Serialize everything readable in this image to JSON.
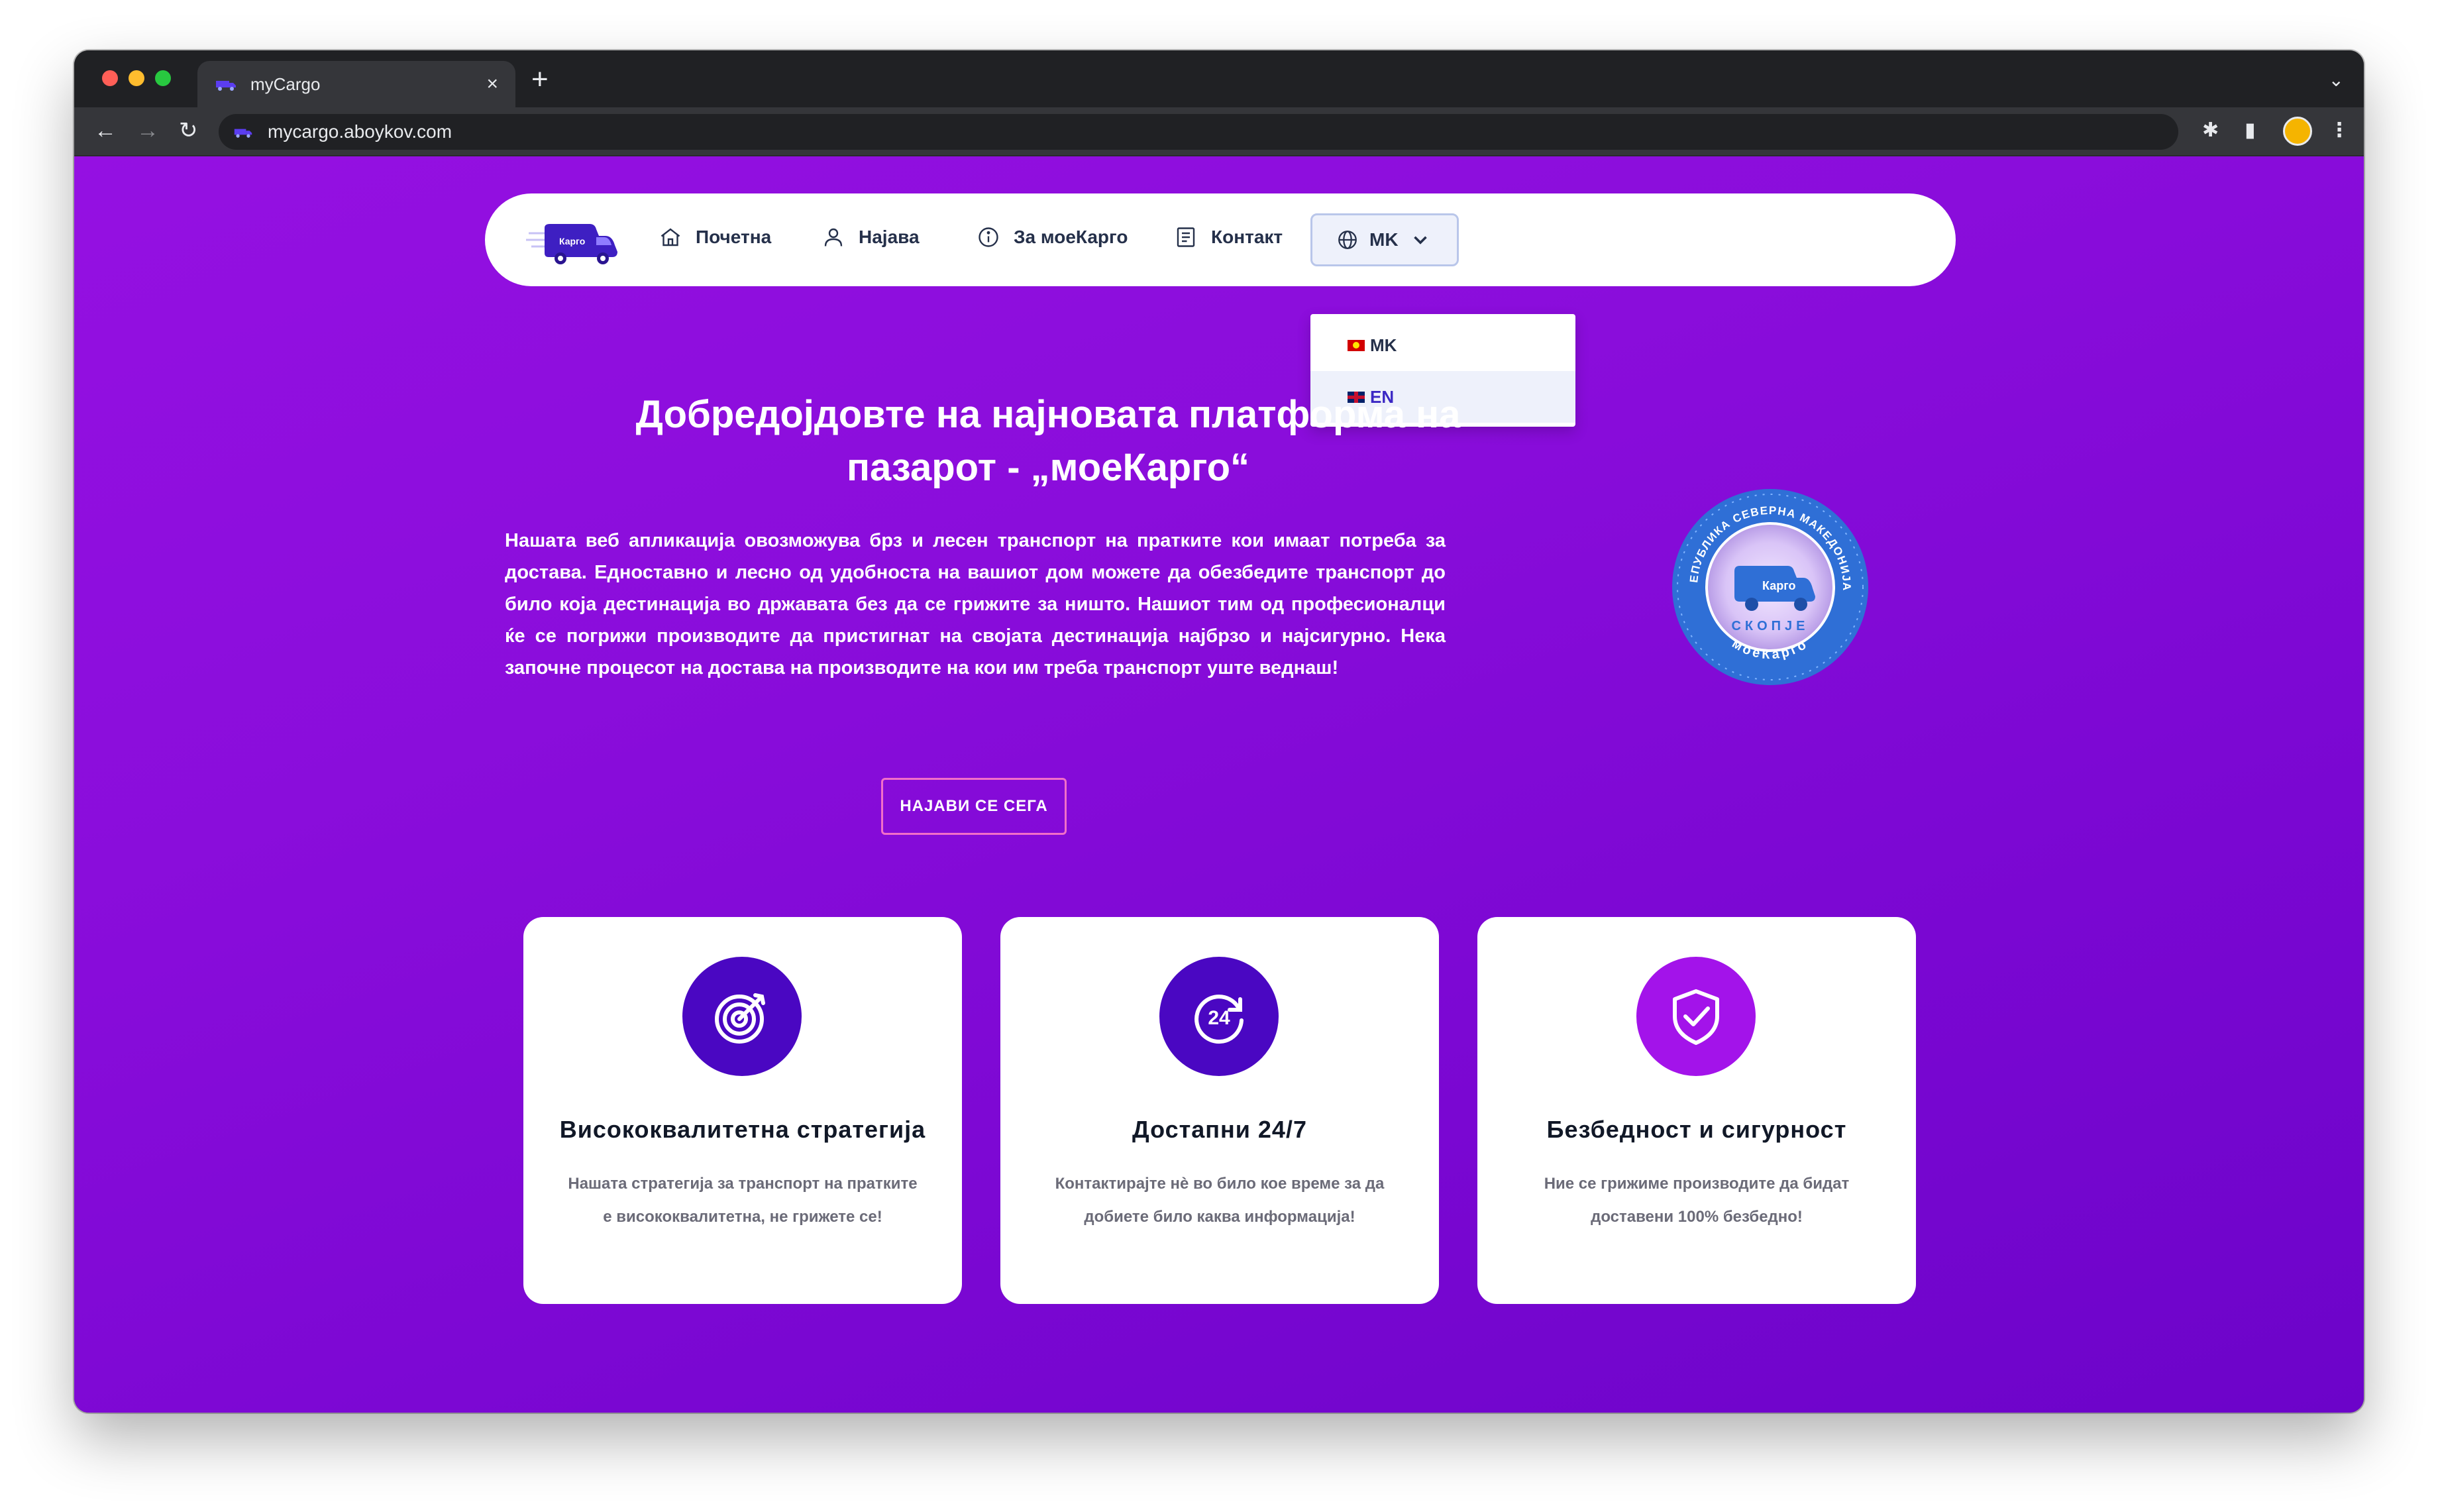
{
  "browser": {
    "tab_title": "myCargo",
    "tab_close": "×",
    "new_tab": "+",
    "tab_menu": "⌄",
    "url": "mycargo.aboykov.com",
    "back": "←",
    "forward": "→",
    "reload": "↻",
    "extensions": "✱",
    "side_panel": "▮",
    "more": "⋮"
  },
  "nav": {
    "items": [
      {
        "label": "Почетна",
        "icon": "home-icon"
      },
      {
        "label": "Најава",
        "icon": "user-icon"
      },
      {
        "label": "За моеКарго",
        "icon": "info-icon"
      },
      {
        "label": "Контакт",
        "icon": "document-icon"
      }
    ],
    "language": {
      "selected": "MK",
      "options": [
        "MK",
        "EN"
      ],
      "highlighted": "EN"
    }
  },
  "logo": {
    "text": "Карго"
  },
  "hero": {
    "title": "Добредојдовте на најновата платформа на пазарот - „моеКарго“",
    "text": "Нашата веб апликација овозможува брз и лесен транспорт на пратките кои имаат потреба за достава. Едноставно и лесно од удобноста на вашиот дом можете да обезбедите транспорт до било која дестинација во државата без да се грижите за ништо. Нашиот тим од професионалци ќе се погрижи производите да пристигнат на својата дестинација најбрзо и најсигурно. Нека започне процесот на достава на производите на кои им треба транспорт уште веднаш!",
    "cta": "НАЈАВИ СЕ СЕГА"
  },
  "seal": {
    "top_text": "моеКарго • РЕПУБЛИКА СЕВЕРНА МАКЕДОНИЈА • моеКарго",
    "city": "СКОПЈЕ",
    "bottom_text": "моеКарго",
    "logo_text": "Карго"
  },
  "cards": [
    {
      "title": "Висококвалитетна стратегија",
      "text": "Нашата стратегија за транспорт на пратките е висококвалитетна, не грижете се!",
      "icon": "target-icon"
    },
    {
      "title": "Достапни 24/7",
      "text": "Контактирајте нè во било кое време за да добиете било каква информација!",
      "icon": "clock-24-icon",
      "badge": "24"
    },
    {
      "title": "Безбедност и сигурност",
      "text": "Ние се грижиме производите да бидат доставени 100% безбедно!",
      "icon": "shield-check-icon"
    }
  ],
  "colors": {
    "brand_purple": "#8a0ddb",
    "icon_dark": "#4a07c2",
    "icon_light": "#a313ea",
    "cta_border": "#f26fc8"
  }
}
